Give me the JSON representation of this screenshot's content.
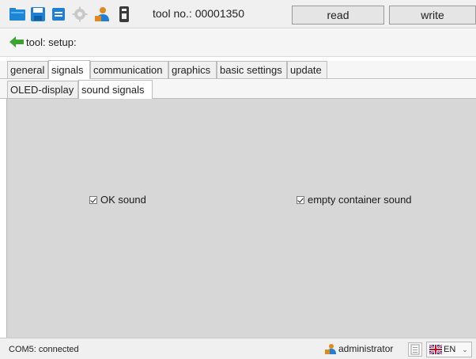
{
  "toolbar": {
    "tool_label": "tool no.: 00001350",
    "read_label": "read",
    "write_label": "write",
    "icons": [
      "folder-open-icon",
      "save-icon",
      "printer-icon",
      "gear-icon",
      "user-config-icon",
      "usb-device-icon"
    ]
  },
  "breadcrumb": {
    "text": "tool: setup:"
  },
  "tabs": [
    {
      "label": "general",
      "active": false
    },
    {
      "label": "signals",
      "active": true
    },
    {
      "label": "communication",
      "active": false
    },
    {
      "label": "graphics",
      "active": false
    },
    {
      "label": "basic settings",
      "active": false
    },
    {
      "label": "update",
      "active": false
    }
  ],
  "subtabs": [
    {
      "label": "OLED-display",
      "active": false
    },
    {
      "label": "sound signals",
      "active": true
    }
  ],
  "options": [
    {
      "label": "OK sound",
      "checked": true
    },
    {
      "label": "empty container sound",
      "checked": true
    }
  ],
  "status": {
    "connection": "COM5: connected",
    "user": "administrator",
    "language": "EN"
  },
  "colors": {
    "content_bg": "#d7d7d7",
    "accent_blue": "#1e7fd4",
    "back_green": "#3aa334",
    "user_orange": "#e08a1e"
  }
}
